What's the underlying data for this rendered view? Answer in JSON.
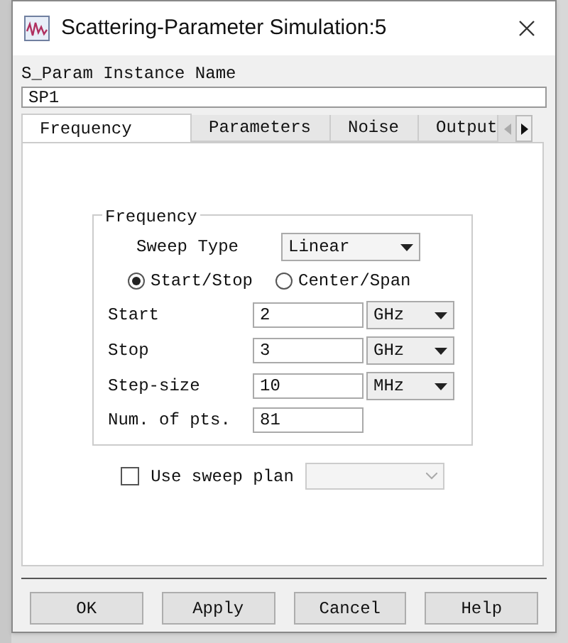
{
  "window": {
    "title": "Scattering-Parameter Simulation:5"
  },
  "instance": {
    "label": "S_Param Instance Name",
    "value": "SP1"
  },
  "tabs": [
    {
      "label": "Frequency",
      "selected": true
    },
    {
      "label": "Parameters",
      "selected": false
    },
    {
      "label": "Noise",
      "selected": false
    },
    {
      "label": "Output",
      "selected": false
    }
  ],
  "frequency_group": {
    "title": "Frequency",
    "sweep_type": {
      "label": "Sweep Type",
      "value": "Linear"
    },
    "modes": [
      {
        "label": "Start/Stop",
        "selected": true
      },
      {
        "label": "Center/Span",
        "selected": false
      }
    ],
    "fields": [
      {
        "label": "Start",
        "value": "2",
        "unit": "GHz"
      },
      {
        "label": "Stop",
        "value": "3",
        "unit": "GHz"
      },
      {
        "label": "Step-size",
        "value": "10",
        "unit": "MHz"
      },
      {
        "label": "Num. of pts.",
        "value": "81"
      }
    ]
  },
  "sweep_plan": {
    "label": "Use sweep plan",
    "checked": false
  },
  "buttons": [
    "OK",
    "Apply",
    "Cancel",
    "Help"
  ]
}
